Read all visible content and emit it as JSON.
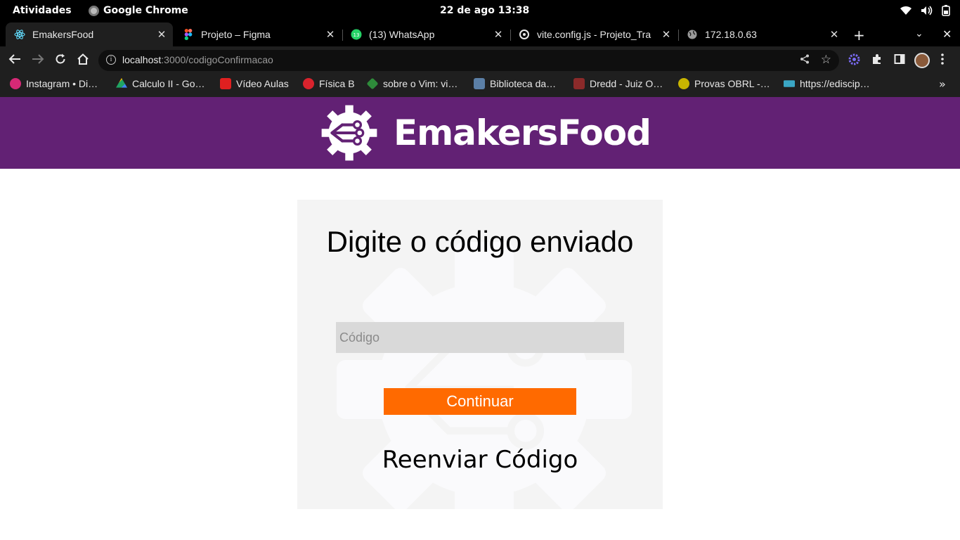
{
  "system_bar": {
    "activities": "Atividades",
    "app_name": "Google Chrome",
    "clock": "22 de ago  13:38"
  },
  "tabs": [
    {
      "label": "EmakersFood",
      "icon": "react-icon",
      "active": true
    },
    {
      "label": "Projeto – Figma",
      "icon": "figma-icon",
      "active": false
    },
    {
      "label": "(13) WhatsApp",
      "icon": "whatsapp-icon",
      "active": false
    },
    {
      "label": "vite.config.js - Projeto_Tra",
      "icon": "github-icon",
      "active": false
    },
    {
      "label": "172.18.0.63",
      "icon": "globe-icon",
      "active": false
    }
  ],
  "address_bar": {
    "host": "localhost",
    "path": ":3000/codigoConfirmacao"
  },
  "bookmarks": [
    {
      "label": "Instagram • Di…",
      "color": "#d62976"
    },
    {
      "label": "Calculo II - Go…",
      "color": "#1fa463"
    },
    {
      "label": "Vídeo Aulas",
      "color": "#e02020"
    },
    {
      "label": "Física B",
      "color": "#d9232d"
    },
    {
      "label": "sobre o Vim: vi…",
      "color": "#2e8b3a"
    },
    {
      "label": "Biblioteca da…",
      "color": "#5b7fa6"
    },
    {
      "label": "Dredd - Juiz O…",
      "color": "#8b2a2a"
    },
    {
      "label": "Provas OBRL -…",
      "color": "#c8b400"
    },
    {
      "label": "https://edisciр…",
      "color": "#3aa6c4"
    }
  ],
  "header": {
    "brand": "EmakersFood",
    "background": "#622174"
  },
  "form": {
    "title": "Digite o código enviado",
    "code_placeholder": "Código",
    "continue_label": "Continuar",
    "resend_label": "Reenviar Código",
    "accent": "#ff6a00"
  }
}
